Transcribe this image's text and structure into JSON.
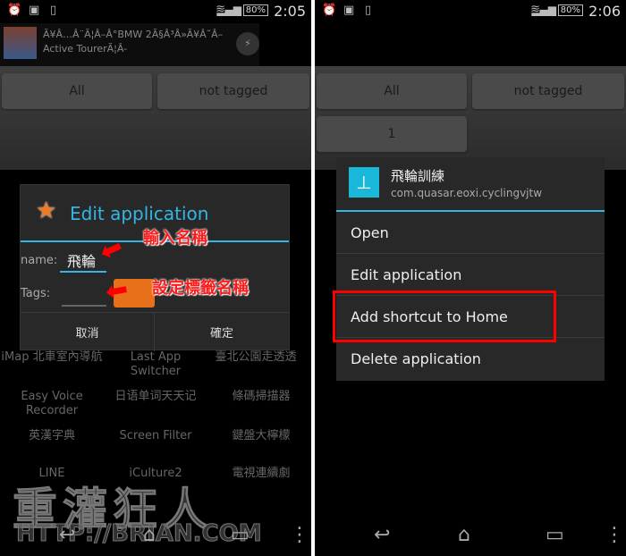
{
  "left": {
    "status": {
      "time": "2:05",
      "battery": "80%",
      "icons": [
        "alarm-icon",
        "image-icon",
        "phone-icon",
        "wifi-icon",
        "signal-icon"
      ]
    },
    "notification": {
      "line1": "Ã¥Â…Â¨Ã¦Â–Â°BMW 2Ã§Â³Â»Ã¥Â˜Â–",
      "line2": "Active TourerÃ¦Â-"
    },
    "tags": [
      "All",
      "not tagged"
    ],
    "grid": [
      "iMap 北車室內導航",
      "Last App Switcher",
      "臺北公園走透透",
      "Easy Voice Recorder",
      "日语单词天天记",
      "條碼掃描器",
      "英漢字典",
      "Screen Filter",
      "鍵盤大檸檬",
      "LINE",
      "iCulture2",
      "電視連續劇"
    ],
    "dialog": {
      "title": "Edit application",
      "name_label": "name:",
      "name_value": "飛輪",
      "tags_label": "Tags:",
      "tags_value": "",
      "cancel": "取消",
      "ok": "確定"
    },
    "annotations": {
      "name": "輸入名稱",
      "tags": "設定標籤名稱"
    },
    "watermark": {
      "text": "重灌狂人",
      "url": "HTTP://BRIAN.COM"
    }
  },
  "right": {
    "status": {
      "time": "2:06",
      "battery": "80%"
    },
    "tags": [
      "All",
      "not tagged",
      "1"
    ],
    "menu": {
      "app_name": "飛輪訓練",
      "package": "com.quasar.eoxi.cyclingvjtw",
      "items": [
        "Open",
        "Edit application",
        "Add shortcut to Home",
        "Delete application"
      ],
      "highlighted": "Add shortcut to Home",
      "highlight_color": "#ff0000"
    }
  },
  "accent": "#33b5e5"
}
